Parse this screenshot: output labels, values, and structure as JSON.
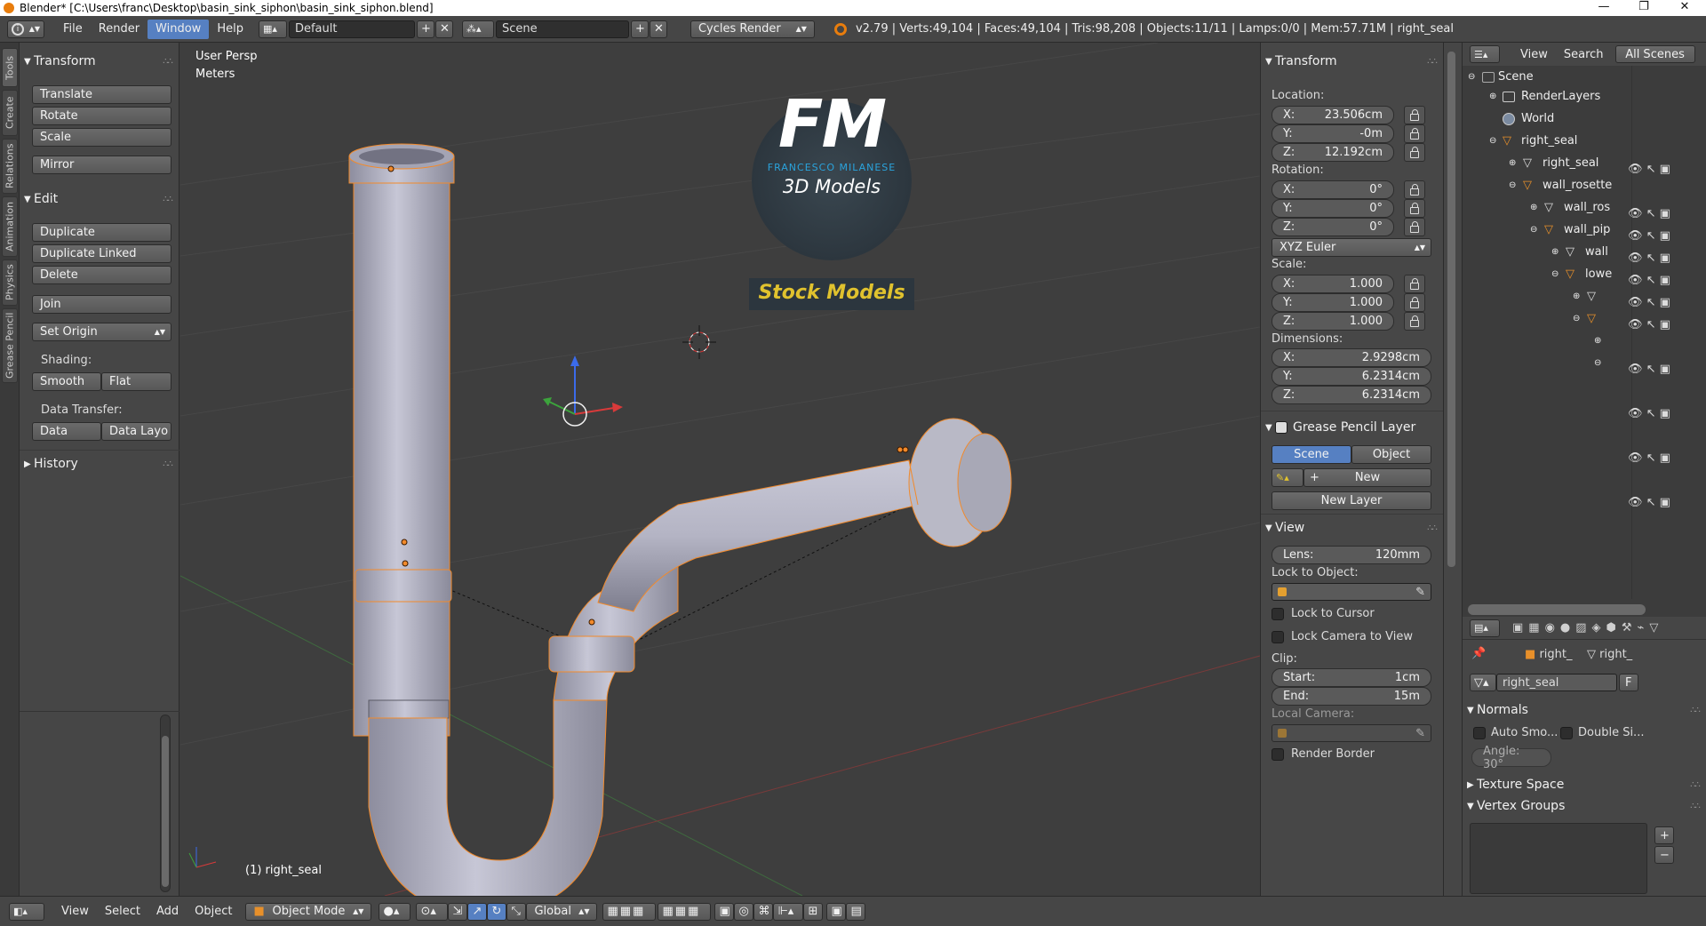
{
  "window": {
    "title": "Blender* [C:\\Users\\franc\\Desktop\\basin_sink_siphon\\basin_sink_siphon.blend]",
    "minimize": "—",
    "maximize": "❐",
    "close": "✕"
  },
  "topbar": {
    "menus": [
      "File",
      "Render",
      "Window",
      "Help"
    ],
    "active_menu": "Window",
    "layout": "Default",
    "scene": "Scene",
    "engine": "Cycles Render",
    "stats": "v2.79 | Verts:49,104 | Faces:49,104 | Tris:98,208 | Objects:11/11 | Lamps:0/0 | Mem:57.71M | right_seal"
  },
  "tool_tabs": [
    "Tools",
    "Create",
    "Relations",
    "Animation",
    "Physics",
    "Grease Pencil"
  ],
  "toolshelf": {
    "transform_title": "Transform",
    "translate": "Translate",
    "rotate": "Rotate",
    "scale": "Scale",
    "mirror": "Mirror",
    "edit_title": "Edit",
    "duplicate": "Duplicate",
    "duplicate_linked": "Duplicate Linked",
    "delete": "Delete",
    "join": "Join",
    "set_origin": "Set Origin",
    "shading_label": "Shading:",
    "smooth": "Smooth",
    "flat": "Flat",
    "data_transfer_label": "Data Transfer:",
    "data": "Data",
    "data_layout": "Data Layo",
    "history_title": "History"
  },
  "viewport": {
    "view_name": "User Persp",
    "units": "Meters",
    "object_label": "(1) right_seal",
    "watermark_letters": "FM",
    "watermark_name": "FRANCESCO MILANESE",
    "watermark_sub": "3D Models",
    "watermark_banner": "Stock Models"
  },
  "npanel": {
    "transform_title": "Transform",
    "location_label": "Location:",
    "loc_x": "23.506cm",
    "loc_y": "-0m",
    "loc_z": "12.192cm",
    "rotation_label": "Rotation:",
    "rot_x": "0°",
    "rot_y": "0°",
    "rot_z": "0°",
    "rotation_mode": "XYZ Euler",
    "scale_label": "Scale:",
    "sc_x": "1.000",
    "sc_y": "1.000",
    "sc_z": "1.000",
    "dimensions_label": "Dimensions:",
    "dim_x": "2.9298cm",
    "dim_y": "6.2314cm",
    "dim_z": "6.2314cm",
    "x": "X:",
    "y": "Y:",
    "z": "Z:",
    "gp_title": "Grease Pencil Layer",
    "gp_scene": "Scene",
    "gp_object": "Object",
    "gp_new": "New",
    "gp_new_layer": "New Layer",
    "view_title": "View",
    "lens_label": "Lens:",
    "lens_value": "120mm",
    "lock_object_label": "Lock to Object:",
    "lock_cursor": "Lock to Cursor",
    "lock_camera": "Lock Camera to View",
    "clip_label": "Clip:",
    "clip_start_label": "Start:",
    "clip_start": "1cm",
    "clip_end_label": "End:",
    "clip_end": "15m",
    "local_camera_label": "Local Camera:",
    "render_border": "Render Border"
  },
  "outliner": {
    "view": "View",
    "search": "Search",
    "display_mode": "All Scenes",
    "items": [
      {
        "label": "Scene",
        "depth": 0
      },
      {
        "label": "RenderLayers",
        "depth": 1
      },
      {
        "label": "World",
        "depth": 1
      },
      {
        "label": "right_seal",
        "depth": 1
      },
      {
        "label": "right_seal",
        "depth": 2
      },
      {
        "label": "wall_rosette",
        "depth": 2
      },
      {
        "label": "wall_ros",
        "depth": 3
      },
      {
        "label": "wall_pip",
        "depth": 3
      },
      {
        "label": "wall",
        "depth": 4
      },
      {
        "label": "lowe",
        "depth": 4
      }
    ]
  },
  "properties": {
    "breadcrumb_a": "right_",
    "breadcrumb_b": "right_",
    "mesh_name": "right_seal",
    "fake_user": "F",
    "normals_title": "Normals",
    "auto_smooth": "Auto Smo...",
    "double_sided": "Double Si...",
    "angle": "Angle: 30°",
    "texture_space": "Texture Space",
    "vertex_groups": "Vertex Groups"
  },
  "bottombar": {
    "view": "View",
    "select": "Select",
    "add": "Add",
    "object": "Object",
    "mode": "Object Mode",
    "orientation": "Global"
  },
  "colors": {
    "accent": "#5680c2",
    "select_orange": "#f28a2b",
    "watermark_blue": "#2aa3dc",
    "watermark_yellow": "#e0c22e",
    "pipe": "#b3b3c4"
  }
}
